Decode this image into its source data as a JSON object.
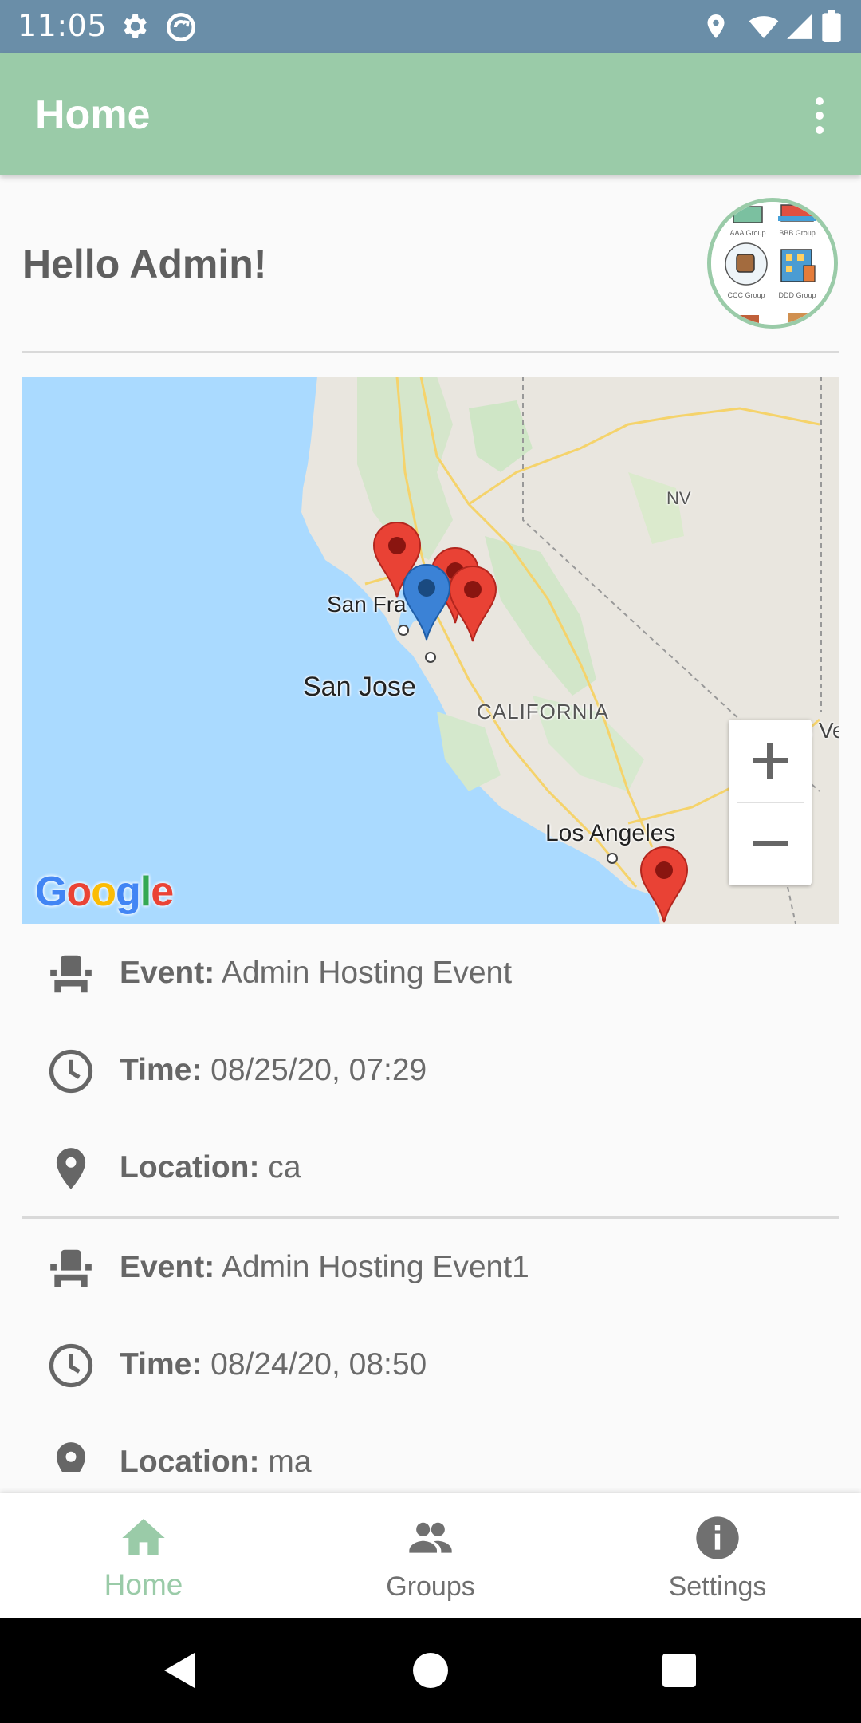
{
  "status_bar": {
    "time": "11:05",
    "left_icons": [
      "settings-gear-icon",
      "sync-icon"
    ],
    "right_icons": [
      "location-icon",
      "wifi-icon",
      "signal-icon",
      "battery-icon"
    ],
    "color": "#6a8ea8"
  },
  "app_bar": {
    "title": "Home",
    "color": "#9acba8",
    "menu_icon": "more-vertical-icon"
  },
  "greeting": "Hello Admin!",
  "avatar": {
    "groups": [
      "AAA Group",
      "BBB Group",
      "CCC Group",
      "DDD Group"
    ]
  },
  "map": {
    "labels": {
      "san_francisco": "San Fra",
      "san_jose": "San Jose",
      "california": "CALIFORNIA",
      "nevada": "NV",
      "los_angeles": "Los Angeles",
      "las_vegas": "Las Ve"
    },
    "zoom_in": "+",
    "zoom_out": "−",
    "logo": "Google",
    "markers": [
      {
        "color": "red"
      },
      {
        "color": "red"
      },
      {
        "color": "red"
      },
      {
        "color": "blue"
      },
      {
        "color": "red"
      }
    ]
  },
  "events": [
    {
      "event_label": "Event:",
      "event_value": "Admin Hosting Event",
      "time_label": "Time:",
      "time_value": "08/25/20, 07:29",
      "location_label": "Location:",
      "location_value": "ca"
    },
    {
      "event_label": "Event:",
      "event_value": "Admin Hosting Event1",
      "time_label": "Time:",
      "time_value": "08/24/20, 08:50",
      "location_label": "Location:",
      "location_value": "ma"
    }
  ],
  "bottom_nav": {
    "items": [
      {
        "label": "Home",
        "icon": "home-icon",
        "active": true
      },
      {
        "label": "Groups",
        "icon": "groups-icon",
        "active": false
      },
      {
        "label": "Settings",
        "icon": "info-icon",
        "active": false
      }
    ],
    "active_color": "#9acba8"
  },
  "system_nav": {
    "buttons": [
      "back-icon",
      "home-circle-icon",
      "recents-icon"
    ]
  }
}
